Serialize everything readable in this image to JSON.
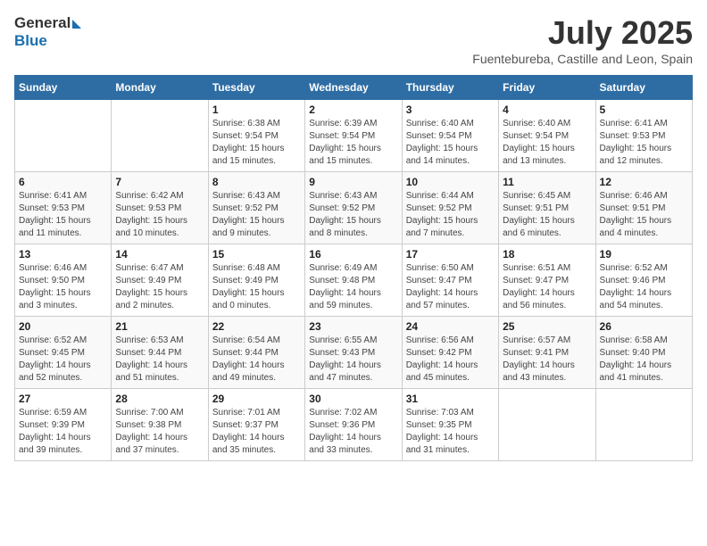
{
  "header": {
    "logo_general": "General",
    "logo_blue": "Blue",
    "month_year": "July 2025",
    "location": "Fuentebureba, Castille and Leon, Spain"
  },
  "weekdays": [
    "Sunday",
    "Monday",
    "Tuesday",
    "Wednesday",
    "Thursday",
    "Friday",
    "Saturday"
  ],
  "weeks": [
    {
      "days": [
        {
          "num": "",
          "detail": ""
        },
        {
          "num": "",
          "detail": ""
        },
        {
          "num": "1",
          "detail": "Sunrise: 6:38 AM\nSunset: 9:54 PM\nDaylight: 15 hours and 15 minutes."
        },
        {
          "num": "2",
          "detail": "Sunrise: 6:39 AM\nSunset: 9:54 PM\nDaylight: 15 hours and 15 minutes."
        },
        {
          "num": "3",
          "detail": "Sunrise: 6:40 AM\nSunset: 9:54 PM\nDaylight: 15 hours and 14 minutes."
        },
        {
          "num": "4",
          "detail": "Sunrise: 6:40 AM\nSunset: 9:54 PM\nDaylight: 15 hours and 13 minutes."
        },
        {
          "num": "5",
          "detail": "Sunrise: 6:41 AM\nSunset: 9:53 PM\nDaylight: 15 hours and 12 minutes."
        }
      ]
    },
    {
      "days": [
        {
          "num": "6",
          "detail": "Sunrise: 6:41 AM\nSunset: 9:53 PM\nDaylight: 15 hours and 11 minutes."
        },
        {
          "num": "7",
          "detail": "Sunrise: 6:42 AM\nSunset: 9:53 PM\nDaylight: 15 hours and 10 minutes."
        },
        {
          "num": "8",
          "detail": "Sunrise: 6:43 AM\nSunset: 9:52 PM\nDaylight: 15 hours and 9 minutes."
        },
        {
          "num": "9",
          "detail": "Sunrise: 6:43 AM\nSunset: 9:52 PM\nDaylight: 15 hours and 8 minutes."
        },
        {
          "num": "10",
          "detail": "Sunrise: 6:44 AM\nSunset: 9:52 PM\nDaylight: 15 hours and 7 minutes."
        },
        {
          "num": "11",
          "detail": "Sunrise: 6:45 AM\nSunset: 9:51 PM\nDaylight: 15 hours and 6 minutes."
        },
        {
          "num": "12",
          "detail": "Sunrise: 6:46 AM\nSunset: 9:51 PM\nDaylight: 15 hours and 4 minutes."
        }
      ]
    },
    {
      "days": [
        {
          "num": "13",
          "detail": "Sunrise: 6:46 AM\nSunset: 9:50 PM\nDaylight: 15 hours and 3 minutes."
        },
        {
          "num": "14",
          "detail": "Sunrise: 6:47 AM\nSunset: 9:49 PM\nDaylight: 15 hours and 2 minutes."
        },
        {
          "num": "15",
          "detail": "Sunrise: 6:48 AM\nSunset: 9:49 PM\nDaylight: 15 hours and 0 minutes."
        },
        {
          "num": "16",
          "detail": "Sunrise: 6:49 AM\nSunset: 9:48 PM\nDaylight: 14 hours and 59 minutes."
        },
        {
          "num": "17",
          "detail": "Sunrise: 6:50 AM\nSunset: 9:47 PM\nDaylight: 14 hours and 57 minutes."
        },
        {
          "num": "18",
          "detail": "Sunrise: 6:51 AM\nSunset: 9:47 PM\nDaylight: 14 hours and 56 minutes."
        },
        {
          "num": "19",
          "detail": "Sunrise: 6:52 AM\nSunset: 9:46 PM\nDaylight: 14 hours and 54 minutes."
        }
      ]
    },
    {
      "days": [
        {
          "num": "20",
          "detail": "Sunrise: 6:52 AM\nSunset: 9:45 PM\nDaylight: 14 hours and 52 minutes."
        },
        {
          "num": "21",
          "detail": "Sunrise: 6:53 AM\nSunset: 9:44 PM\nDaylight: 14 hours and 51 minutes."
        },
        {
          "num": "22",
          "detail": "Sunrise: 6:54 AM\nSunset: 9:44 PM\nDaylight: 14 hours and 49 minutes."
        },
        {
          "num": "23",
          "detail": "Sunrise: 6:55 AM\nSunset: 9:43 PM\nDaylight: 14 hours and 47 minutes."
        },
        {
          "num": "24",
          "detail": "Sunrise: 6:56 AM\nSunset: 9:42 PM\nDaylight: 14 hours and 45 minutes."
        },
        {
          "num": "25",
          "detail": "Sunrise: 6:57 AM\nSunset: 9:41 PM\nDaylight: 14 hours and 43 minutes."
        },
        {
          "num": "26",
          "detail": "Sunrise: 6:58 AM\nSunset: 9:40 PM\nDaylight: 14 hours and 41 minutes."
        }
      ]
    },
    {
      "days": [
        {
          "num": "27",
          "detail": "Sunrise: 6:59 AM\nSunset: 9:39 PM\nDaylight: 14 hours and 39 minutes."
        },
        {
          "num": "28",
          "detail": "Sunrise: 7:00 AM\nSunset: 9:38 PM\nDaylight: 14 hours and 37 minutes."
        },
        {
          "num": "29",
          "detail": "Sunrise: 7:01 AM\nSunset: 9:37 PM\nDaylight: 14 hours and 35 minutes."
        },
        {
          "num": "30",
          "detail": "Sunrise: 7:02 AM\nSunset: 9:36 PM\nDaylight: 14 hours and 33 minutes."
        },
        {
          "num": "31",
          "detail": "Sunrise: 7:03 AM\nSunset: 9:35 PM\nDaylight: 14 hours and 31 minutes."
        },
        {
          "num": "",
          "detail": ""
        },
        {
          "num": "",
          "detail": ""
        }
      ]
    }
  ]
}
